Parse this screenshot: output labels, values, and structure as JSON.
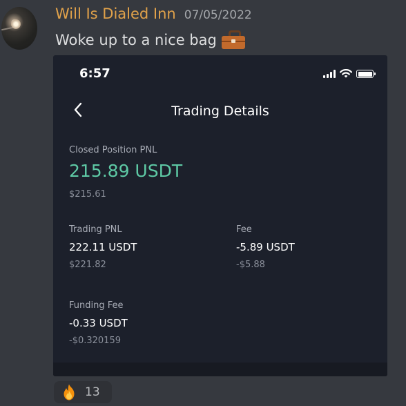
{
  "message": {
    "username": "Will Is Dialed Inn",
    "timestamp": "07/05/2022",
    "text": "Woke up to a nice bag",
    "emoji_icon": "briefcase-icon",
    "username_color": "#e1a24a"
  },
  "phone": {
    "status": {
      "time": "6:57",
      "icons": [
        "cellular-signal-icon",
        "wifi-icon",
        "battery-icon"
      ]
    },
    "nav": {
      "back_icon": "chevron-left-icon",
      "title": "Trading Details"
    },
    "closed_pnl": {
      "label": "Closed Position PNL",
      "value": "215.89 USDT",
      "sub": "$215.61",
      "color": "#5ec9a5"
    },
    "trading_pnl": {
      "label": "Trading PNL",
      "value": "222.11 USDT",
      "sub": "$221.82"
    },
    "fee": {
      "label": "Fee",
      "value": "-5.89 USDT",
      "sub": "-$5.88"
    },
    "funding_fee": {
      "label": "Funding Fee",
      "value": "-0.33 USDT",
      "sub": "-$0.320159"
    }
  },
  "reaction": {
    "icon": "fire-icon",
    "count": "13"
  }
}
